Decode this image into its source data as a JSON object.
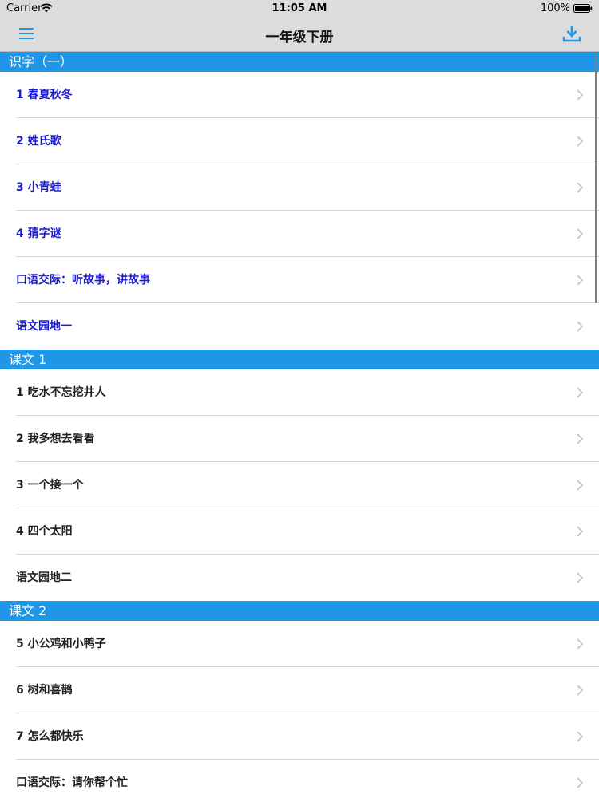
{
  "status_bar": {
    "carrier": "Carrier",
    "time": "11:05 AM",
    "battery": "100%"
  },
  "nav": {
    "title": "一年级下册",
    "menu_icon": "hamburger-menu-icon",
    "download_icon": "download-icon",
    "accent_color": "#1f96e6"
  },
  "colors": {
    "section_header": "#1f96e6",
    "row_text_blue": "#1b1bcf",
    "row_text_dark": "#222222"
  },
  "sections": [
    {
      "title": "识字（一）",
      "rows": [
        "1 春夏秋冬",
        "2 姓氏歌",
        "3 小青蛙",
        "4 猜字谜",
        "口语交际：听故事，讲故事",
        "语文园地一"
      ]
    },
    {
      "title": "课文 1",
      "rows": [
        "1 吃水不忘挖井人",
        "2 我多想去看看",
        "3 一个接一个",
        "4 四个太阳",
        "语文园地二"
      ]
    },
    {
      "title": "课文 2",
      "rows": [
        "5 小公鸡和小鸭子",
        "6 树和喜鹊",
        "7 怎么都快乐",
        "口语交际：请你帮个忙"
      ]
    }
  ]
}
